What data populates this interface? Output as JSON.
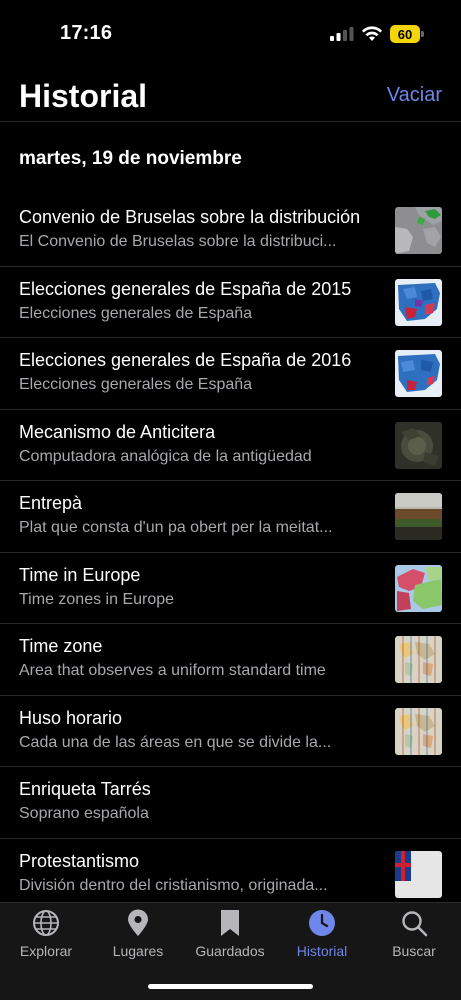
{
  "status": {
    "time": "17:16",
    "battery": "60"
  },
  "header": {
    "title": "Historial",
    "clear_label": "Vaciar"
  },
  "date_header": "martes, 19 de noviembre",
  "items": [
    {
      "title": "Convenio de Bruselas sobre la distribución",
      "description": "El Convenio de Bruselas sobre la distribuci...",
      "thumbnail": "map-thumbnail"
    },
    {
      "title": "Elecciones generales de España de 2015",
      "description": "Elecciones generales de España",
      "thumbnail": "election-map-thumbnail"
    },
    {
      "title": "Elecciones generales de España de 2016",
      "description": "Elecciones generales de España",
      "thumbnail": "election-map-thumbnail"
    },
    {
      "title": "Mecanismo de Anticitera",
      "description": "Computadora analógica de la antigüedad",
      "thumbnail": "artifact-thumbnail"
    },
    {
      "title": "Entrepà",
      "description": "Plat que consta d'un pa obert per la meitat...",
      "thumbnail": "sandwich-thumbnail"
    },
    {
      "title": "Time in Europe",
      "description": "Time zones in Europe",
      "thumbnail": "europe-map-thumbnail"
    },
    {
      "title": "Time zone",
      "description": "Area that observes a uniform standard time",
      "thumbnail": "world-map-thumbnail"
    },
    {
      "title": "Huso horario",
      "description": "Cada una de las áreas en que se divide la...",
      "thumbnail": "world-map-thumbnail"
    },
    {
      "title": "Enriqueta Tarrés",
      "description": "Soprano española",
      "thumbnail": ""
    },
    {
      "title": "Protestantismo",
      "description": "División dentro del cristianismo, originada...",
      "thumbnail": "flag-thumbnail"
    }
  ],
  "tabs": [
    {
      "label": "Explorar",
      "icon": "globe-icon",
      "active": false
    },
    {
      "label": "Lugares",
      "icon": "map-pin-icon",
      "active": false
    },
    {
      "label": "Guardados",
      "icon": "bookmark-icon",
      "active": false
    },
    {
      "label": "Historial",
      "icon": "clock-icon",
      "active": true
    },
    {
      "label": "Buscar",
      "icon": "search-icon",
      "active": false
    }
  ],
  "colors": {
    "accent": "#6f86ea",
    "background": "#000000",
    "secondary_text": "#a8a8ad",
    "tab_bar": "#161616"
  }
}
